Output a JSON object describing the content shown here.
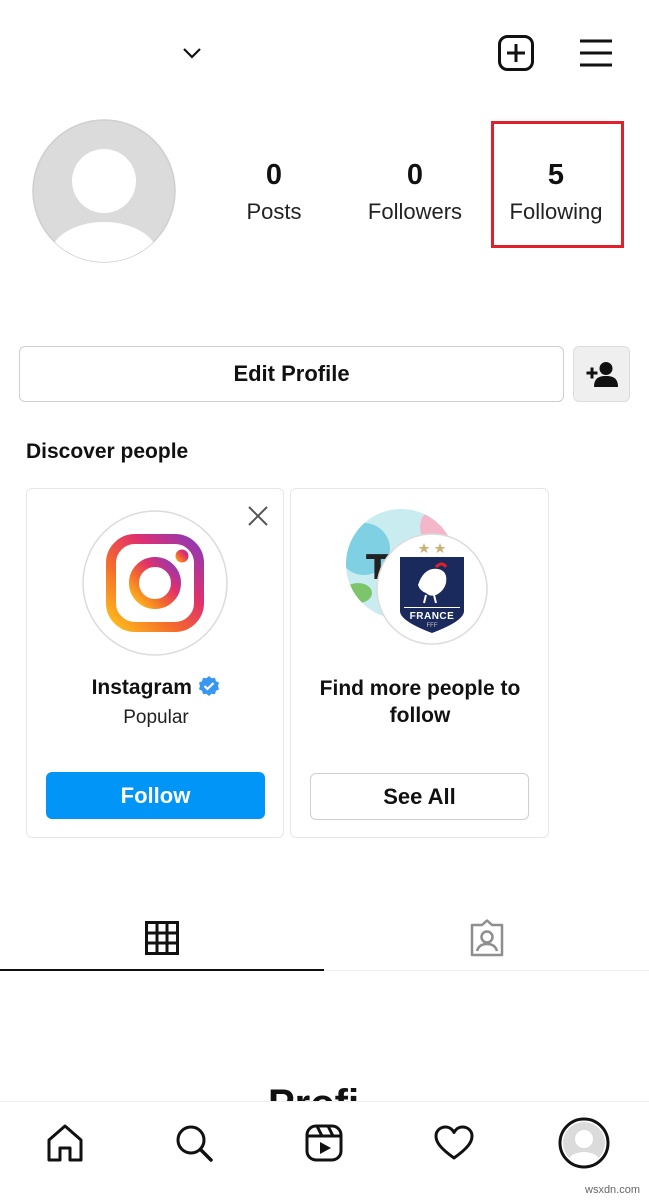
{
  "profile": {
    "stats": [
      {
        "value": "0",
        "label": "Posts"
      },
      {
        "value": "0",
        "label": "Followers"
      },
      {
        "value": "5",
        "label": "Following"
      }
    ],
    "highlight_color": "#e0212c"
  },
  "actions": {
    "edit_profile": "Edit Profile"
  },
  "discover": {
    "title": "Discover people",
    "card1": {
      "name": "Instagram",
      "subtitle": "Popular",
      "button": "Follow",
      "verified": true
    },
    "card2": {
      "title": "Find more people to follow",
      "button": "See All",
      "badge_text": "FRANCE",
      "badge_small": "FFF"
    }
  },
  "partial_text": "Profi",
  "watermark": "wsxdn.com",
  "colors": {
    "accent": "#0095f6",
    "border": "#dbdbdb"
  },
  "icons": {
    "header": [
      "chevron-down-icon",
      "add-post-icon",
      "menu-icon"
    ],
    "tabs": [
      "grid-icon",
      "tagged-icon"
    ],
    "nav": [
      "home-icon",
      "search-icon",
      "reels-icon",
      "heart-icon",
      "profile-avatar-icon"
    ]
  }
}
